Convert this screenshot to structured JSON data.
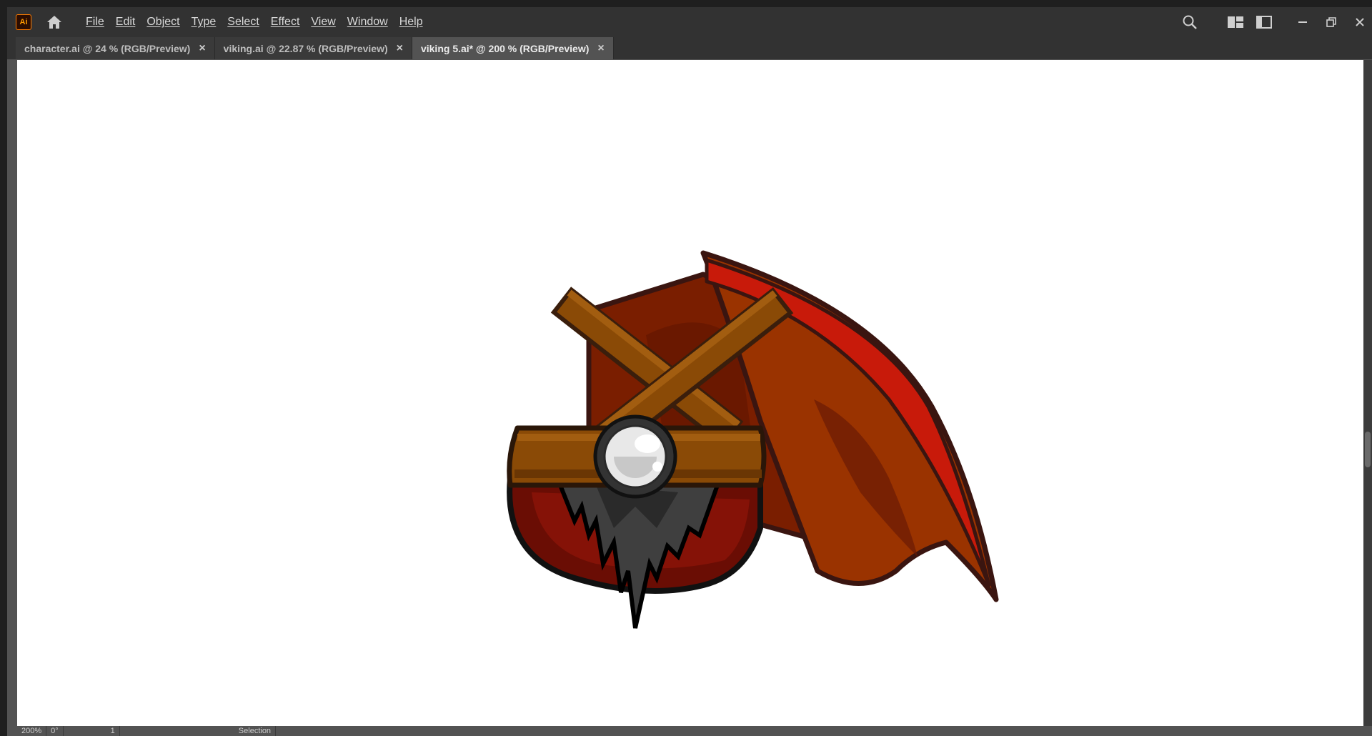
{
  "app": {
    "logo_text": "Ai"
  },
  "menu": [
    "File",
    "Edit",
    "Object",
    "Type",
    "Select",
    "Effect",
    "View",
    "Window",
    "Help"
  ],
  "tabs": [
    {
      "label": "character.ai @ 24 % (RGB/Preview)",
      "active": false
    },
    {
      "label": "viking.ai @ 22.87 % (RGB/Preview)",
      "active": false
    },
    {
      "label": "viking 5.ai* @ 200 % (RGB/Preview)",
      "active": true
    }
  ],
  "tab_close_glyph": "×",
  "status": {
    "zoom": "200%",
    "angle": "0°",
    "artboard": "1",
    "tool": "Selection"
  },
  "icons": [
    "home-icon",
    "search-icon",
    "arrange-documents-icon",
    "workspace-icon",
    "minimize-icon",
    "restore-icon",
    "close-icon"
  ],
  "colors": {
    "chrome": "#323232",
    "canvas": "#ffffff",
    "accent": "#ff7c00"
  }
}
